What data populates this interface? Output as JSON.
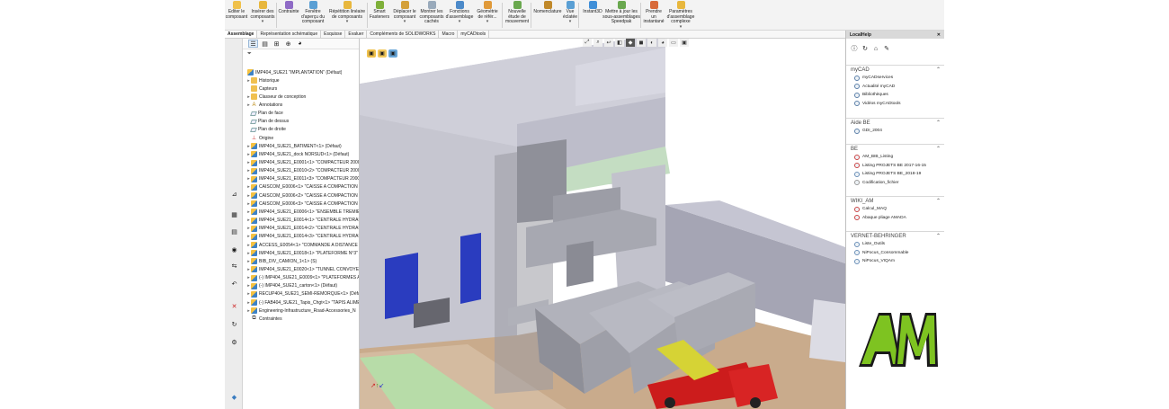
{
  "ribbon": {
    "buttons": [
      {
        "label": "Editer le composant",
        "icon": "edit-component-icon",
        "has_caret": false
      },
      {
        "label": "Insérer des composants",
        "icon": "insert-components-icon",
        "has_caret": true
      },
      {
        "label": "Contrainte",
        "icon": "mate-icon",
        "has_caret": false
      },
      {
        "label": "Fenêtre d'aperçu du composant",
        "icon": "component-preview-icon",
        "has_caret": false
      },
      {
        "label": "Répétition linéaire de composants",
        "icon": "linear-pattern-icon",
        "has_caret": true
      },
      {
        "label": "Smart Fasteners",
        "icon": "smart-fasteners-icon",
        "has_caret": false
      },
      {
        "label": "Déplacer le composant",
        "icon": "move-component-icon",
        "has_caret": true
      },
      {
        "label": "Montrer les composants cachés",
        "icon": "show-hidden-icon",
        "has_caret": false
      },
      {
        "label": "Fonctions d'assemblage",
        "icon": "assembly-features-icon",
        "has_caret": true
      },
      {
        "label": "Géométrie de référ...",
        "icon": "reference-geometry-icon",
        "has_caret": true
      },
      {
        "label": "Nouvelle étude de mouvement",
        "icon": "motion-study-icon",
        "has_caret": false
      },
      {
        "label": "Nomenclature",
        "icon": "bom-icon",
        "has_caret": false
      },
      {
        "label": "Vue éclatée",
        "icon": "exploded-view-icon",
        "has_caret": true
      },
      {
        "label": "Instant3D",
        "icon": "instant3d-icon",
        "has_caret": false
      },
      {
        "label": "Mettre à jour les sous-assemblages Speedpak",
        "icon": "speedpak-icon",
        "has_caret": false
      },
      {
        "label": "Prendre un instantané",
        "icon": "snapshot-icon",
        "has_caret": false
      },
      {
        "label": "Paramètres d'assemblage complexe",
        "icon": "large-assembly-icon",
        "has_caret": true
      }
    ]
  },
  "tabs": [
    {
      "label": "Assemblage",
      "active": true
    },
    {
      "label": "Représentation schématique",
      "active": false
    },
    {
      "label": "Esquisse",
      "active": false
    },
    {
      "label": "Evaluer",
      "active": false
    },
    {
      "label": "Compléments de SOLIDWORKS",
      "active": false
    },
    {
      "label": "Macro",
      "active": false
    },
    {
      "label": "myCADtools",
      "active": false
    }
  ],
  "feature_tree": {
    "filter_icon": "filter-icon",
    "root": "IMP404_SUE21 \"IMPLANTATION\" (Défaut)",
    "items": [
      {
        "label": "Historique",
        "icon": "history-folder-icon",
        "level": 1,
        "expand": "▸"
      },
      {
        "label": "Capteurs",
        "icon": "sensor-icon",
        "level": 1,
        "expand": ""
      },
      {
        "label": "Classeur de conception",
        "icon": "design-binder-icon",
        "level": 1,
        "expand": "▸"
      },
      {
        "label": "Annotations",
        "icon": "annotations-icon",
        "level": 1,
        "expand": "▸"
      },
      {
        "label": "Plan de face",
        "icon": "plane-icon",
        "level": 1,
        "expand": ""
      },
      {
        "label": "Plan de dessus",
        "icon": "plane-icon",
        "level": 1,
        "expand": ""
      },
      {
        "label": "Plan de droite",
        "icon": "plane-icon",
        "level": 1,
        "expand": ""
      },
      {
        "label": "Origine",
        "icon": "origin-icon",
        "level": 1,
        "expand": ""
      },
      {
        "label": "IMP404_SUE21_BATIMENT<1> (Défaut)",
        "icon": "assembly-icon",
        "level": 1,
        "expand": "▸"
      },
      {
        "label": "IMP404_SUE21_dock NORSUD<1> (Défaut)",
        "icon": "assembly-icon",
        "level": 1,
        "expand": "▸"
      },
      {
        "label": "IMP404_SUE21_E0001<1> \"COMPACTEUR 20005",
        "icon": "assembly-icon",
        "level": 1,
        "expand": "▸"
      },
      {
        "label": "IMP404_SUE21_E0010<2> \"COMPACTEUR 20005",
        "icon": "assembly-icon",
        "level": 1,
        "expand": "▸"
      },
      {
        "label": "IMP404_SUE21_E0011<3> \"COMPACTEUR 20005",
        "icon": "assembly-icon",
        "level": 1,
        "expand": "▸"
      },
      {
        "label": "CAISCOM_E0006<1> \"CAISSE A COMPACTION",
        "icon": "assembly-icon",
        "level": 1,
        "expand": "▸"
      },
      {
        "label": "CAISCOM_E0006<2> \"CAISSE A COMPACTION",
        "icon": "assembly-icon",
        "level": 1,
        "expand": "▸"
      },
      {
        "label": "CAISCOM_E0006<3> \"CAISSE A COMPACTION",
        "icon": "assembly-icon",
        "level": 1,
        "expand": "▸"
      },
      {
        "label": "IMP404_SUE21_E0006<1> \"ENSEMBLE TREMIE\"",
        "icon": "assembly-icon",
        "level": 1,
        "expand": "▸"
      },
      {
        "label": "IMP404_SUE21_E0014<1> \"CENTRALE HYDRAUL",
        "icon": "assembly-icon",
        "level": 1,
        "expand": "▸"
      },
      {
        "label": "IMP404_SUE21_E0014<2> \"CENTRALE HYDRAUL",
        "icon": "assembly-icon",
        "level": 1,
        "expand": "▸"
      },
      {
        "label": "IMP404_SUE21_E0014<3> \"CENTRALE HYDRAUL",
        "icon": "assembly-icon",
        "level": 1,
        "expand": "▸"
      },
      {
        "label": "ACCESS_E0054<1> \"COMMANDE A DISTANCE -",
        "icon": "assembly-icon",
        "level": 1,
        "expand": "▸"
      },
      {
        "label": "IMP404_SUE21_E0018<1> \"PLATEFORME N°3\" (D",
        "icon": "assembly-icon",
        "level": 1,
        "expand": "▸"
      },
      {
        "label": "BIB_DIV_CAMION_1<1> (S)",
        "icon": "assembly-icon",
        "level": 1,
        "expand": "▸"
      },
      {
        "label": "IMP404_SUE21_E0020<1> \"TUNNEL CONVOYEUR",
        "icon": "assembly-icon",
        "level": 1,
        "expand": "▸"
      },
      {
        "label": "(-) IMP404_SUE21_E0009<1> \"PLATEFORMES AC",
        "icon": "assembly-icon",
        "level": 1,
        "expand": "▸"
      },
      {
        "label": "(-) IMP404_SUE21_carton<1> (Défaut)",
        "icon": "assembly-icon",
        "level": 1,
        "expand": "▸"
      },
      {
        "label": "RECUP404_SUE21_SEMI-REMORQUE<1> (Défaut",
        "icon": "assembly-icon",
        "level": 1,
        "expand": "▸"
      },
      {
        "label": "(-) FAB404_SUE21_Tapis_Chgt<1> \"TAPIS ALIME",
        "icon": "assembly-icon",
        "level": 1,
        "expand": "▸"
      },
      {
        "label": "Engineering-Infrastructure_Road-Accessories_N",
        "icon": "assembly-icon",
        "level": 1,
        "expand": "▸"
      },
      {
        "label": "Contraintes",
        "icon": "mates-folder-icon",
        "level": 1,
        "expand": ""
      }
    ]
  },
  "task_pane": {
    "title": "LocalHelp",
    "sections": [
      {
        "title": "myCAD",
        "items": [
          "myCADservices",
          "Actualité myCAD",
          "Bibliothèques",
          "Vidéos myCADtools"
        ]
      },
      {
        "title": "Aide BE",
        "items": [
          "GDI_2004"
        ]
      },
      {
        "title": "BE",
        "items": [
          "AM_BIB_Listing",
          "Listing PROJETS BE 2017-16-15",
          "Listing PROJETS BE_2018-19",
          "Codification_fichier"
        ]
      },
      {
        "title": "WIKI_AM",
        "items": [
          "Calcul_MAQ",
          "Abaque pliage AMADA"
        ]
      },
      {
        "title": "VERNET-BEHRINGER",
        "items": [
          "Liste_Outils",
          "NiPocus_Consommable",
          "NiPocus_VIQAm"
        ]
      }
    ]
  },
  "logo": {
    "text": "AM",
    "colors": [
      "#7ec321",
      "#1a1a1a"
    ]
  },
  "colors": {
    "wall": "#c9c8d4",
    "steel": "#8e8f96",
    "floor": "#c4a88a",
    "door": "#2438b8",
    "truck_cab": "#cc1b1b",
    "accent_green": "#7ec321"
  }
}
